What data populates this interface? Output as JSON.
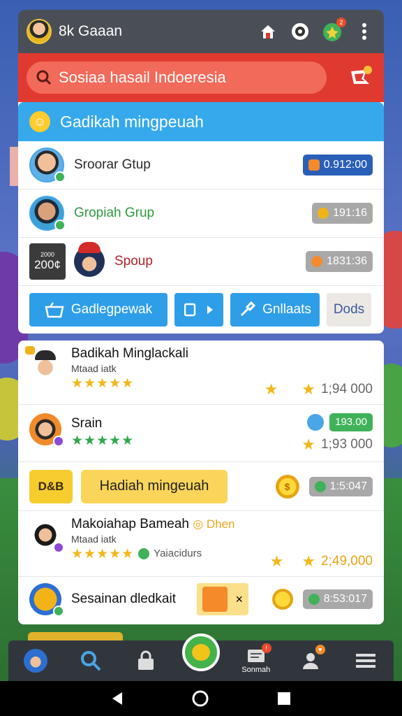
{
  "app": {
    "title": "8k Gaaan",
    "notif_count": "2"
  },
  "search": {
    "placeholder": "Sosiaa hasail Indoeresia"
  },
  "card1": {
    "header": "Gadikah mingpeuah",
    "rows": [
      {
        "name": "Sroorar Gtup",
        "value": "0.912:00",
        "pill_color": "#2a5fb8"
      },
      {
        "name": "Gropiah Grup",
        "value": "191:16",
        "pill_color": "#a8a8a8"
      },
      {
        "name": "Spoup",
        "value": "1831:36",
        "pill_color": "#a8a8a8",
        "thumb_small": "2000",
        "thumb_big": "200¢"
      }
    ],
    "buttons": {
      "gift": "Gadlegpewak",
      "play": "",
      "gifts": "Gnllaats",
      "deals": "Dods"
    }
  },
  "card2": {
    "rows": [
      {
        "title": "Badikah Minglackali",
        "subtitle": "Mtaad iatk",
        "stars": "★★★★★",
        "value": "1;94 000"
      },
      {
        "title": "Srain",
        "subtitle": "",
        "stars": "★★★★★",
        "value": "1;93 000",
        "badge_value": "193.00"
      },
      {
        "tag": "D&B",
        "banner": "Hadiah mingeuah",
        "value": "1:5:047"
      },
      {
        "title": "Makoiahap Bameah",
        "suffix": "Dhen",
        "subtitle": "Mtaad iatk",
        "stars": "★★★★★",
        "extra": "Yaiacidurs",
        "value": "2;49,000"
      },
      {
        "title": "Sesainan dledkait",
        "chip_x": "×",
        "value": "8:53:017"
      }
    ]
  },
  "nav": {
    "items": [
      "profile",
      "search",
      "lock",
      "home",
      "messages",
      "account",
      "menu"
    ],
    "messages_label": "Sonmah"
  },
  "colors": {
    "red": "#e03a30",
    "blue": "#35a9ec",
    "green": "#43b34a",
    "dark": "#4a4f57"
  }
}
